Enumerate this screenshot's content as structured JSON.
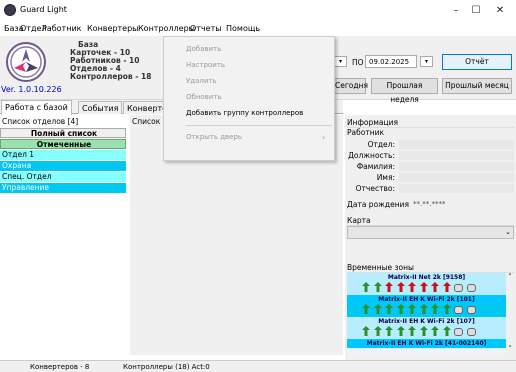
{
  "window": {
    "title": "Guard Light",
    "min": "–",
    "max": "☐",
    "close": "✕"
  },
  "menu": [
    "База",
    "Отдел",
    "Работник",
    "Конвертеры",
    "Контроллеры",
    "Отчеты",
    "Помощь"
  ],
  "stats": {
    "base": "База",
    "cards": "Карточек - 10",
    "workers": "Работников - 10",
    "depts": "Отделов - 4",
    "controllers": "Контроллеров - 18"
  },
  "version": "Ver. 1.0.10.226",
  "period": {
    "to_label": "ПО",
    "to_date": "09.02.2025",
    "report": "Отчёт",
    "today": "Сегодня",
    "last_week": "Прошлая неделя",
    "last_month": "Прошлый месяц"
  },
  "tabs": [
    "Работа с базой",
    "События",
    "Конверте..."
  ],
  "left": {
    "header": "Список отделов [4]",
    "full_list": "Полный список",
    "marked": "Отмеченные",
    "depts": [
      "Отдел 1",
      "Охрана",
      "Спец. Отдел",
      "Управление"
    ]
  },
  "list_label": "Список",
  "info": {
    "title": "Информация",
    "worker": "Работник",
    "fields": [
      "Отдел:",
      "Должность:",
      "Фамилия:",
      "Имя:",
      "Отчество:"
    ],
    "birth_label": "Дата рождения",
    "birth_value": "**.**.****"
  },
  "map": {
    "title": "Карта"
  },
  "zones": {
    "title": "Временные зоны",
    "items": [
      "Matrix-II Net 2k [9158]",
      "Matrix-II EH K Wi-Fi 2k [101]",
      "Matrix-II EH K Wi-Fi 2k [107]",
      "Matrix-II EH K Wi-Fi 2k [41-002140]"
    ]
  },
  "dropdown": {
    "items": [
      "Добавить",
      "Настроить",
      "Удалить",
      "Обновить",
      "Добавить группу контроллеров",
      "Открыть дверь"
    ]
  },
  "status": {
    "converters": "Конвертеров - 8",
    "controllers": "Контроллеры (18) Act:0"
  },
  "colors": {
    "accent": "#00b8f0",
    "highlight": "#00ffff",
    "purple": "#6b5a8e"
  }
}
